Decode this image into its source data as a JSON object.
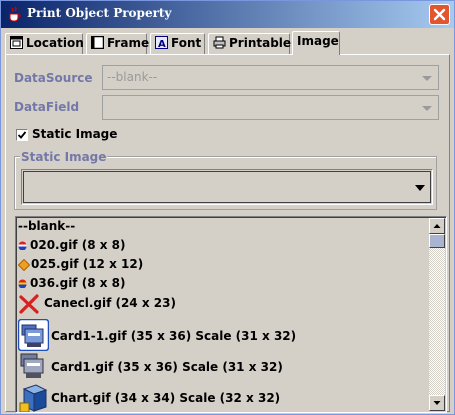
{
  "window": {
    "title": "Print Object Property",
    "icon": "coffee-cup-icon",
    "close_icon": "close-icon"
  },
  "tabs": [
    {
      "label": "Location",
      "icon": "location-icon",
      "active": false
    },
    {
      "label": "Frame",
      "icon": "frame-icon",
      "active": false
    },
    {
      "label": "Font",
      "icon": "font-icon",
      "active": false
    },
    {
      "label": "Printable",
      "icon": "printer-icon",
      "active": false
    },
    {
      "label": "Image",
      "icon": "",
      "active": true
    }
  ],
  "form": {
    "datasource_label": "DataSource",
    "datasource_value": "--blank--",
    "datafield_label": "DataField",
    "datafield_value": "",
    "static_image_checkbox_label": "Static Image",
    "static_image_checked": true,
    "static_image_group_title": "Static Image",
    "static_image_value": ""
  },
  "list": {
    "items": [
      {
        "text": "--blank--",
        "icon": ""
      },
      {
        "text": "020.gif  (8 x 8)",
        "icon": "tricolor-dot-icon"
      },
      {
        "text": "025.gif  (12 x 12)",
        "icon": "orange-diamond-icon"
      },
      {
        "text": "036.gif  (8 x 8)",
        "icon": "tricolor-dot-icon"
      },
      {
        "text": "Canecl.gif  (24 x 23)",
        "icon": "red-x-icon"
      },
      {
        "text": "Card1-1.gif  (35 x 36)  Scale (31 x 32)",
        "icon": "card-reader-selected-icon"
      },
      {
        "text": "Card1.gif  (35 x 36)  Scale (31 x 32)",
        "icon": "card-reader-icon"
      },
      {
        "text": "Chart.gif  (34 x 34)  Scale (32 x 32)",
        "icon": "chart-cube-icon"
      }
    ]
  },
  "colors": {
    "label_lavender": "#7378a8",
    "title_gradient_start": "#0a246a",
    "close_red": "#e2552d",
    "dialog_bg": "#d4d0c8"
  }
}
